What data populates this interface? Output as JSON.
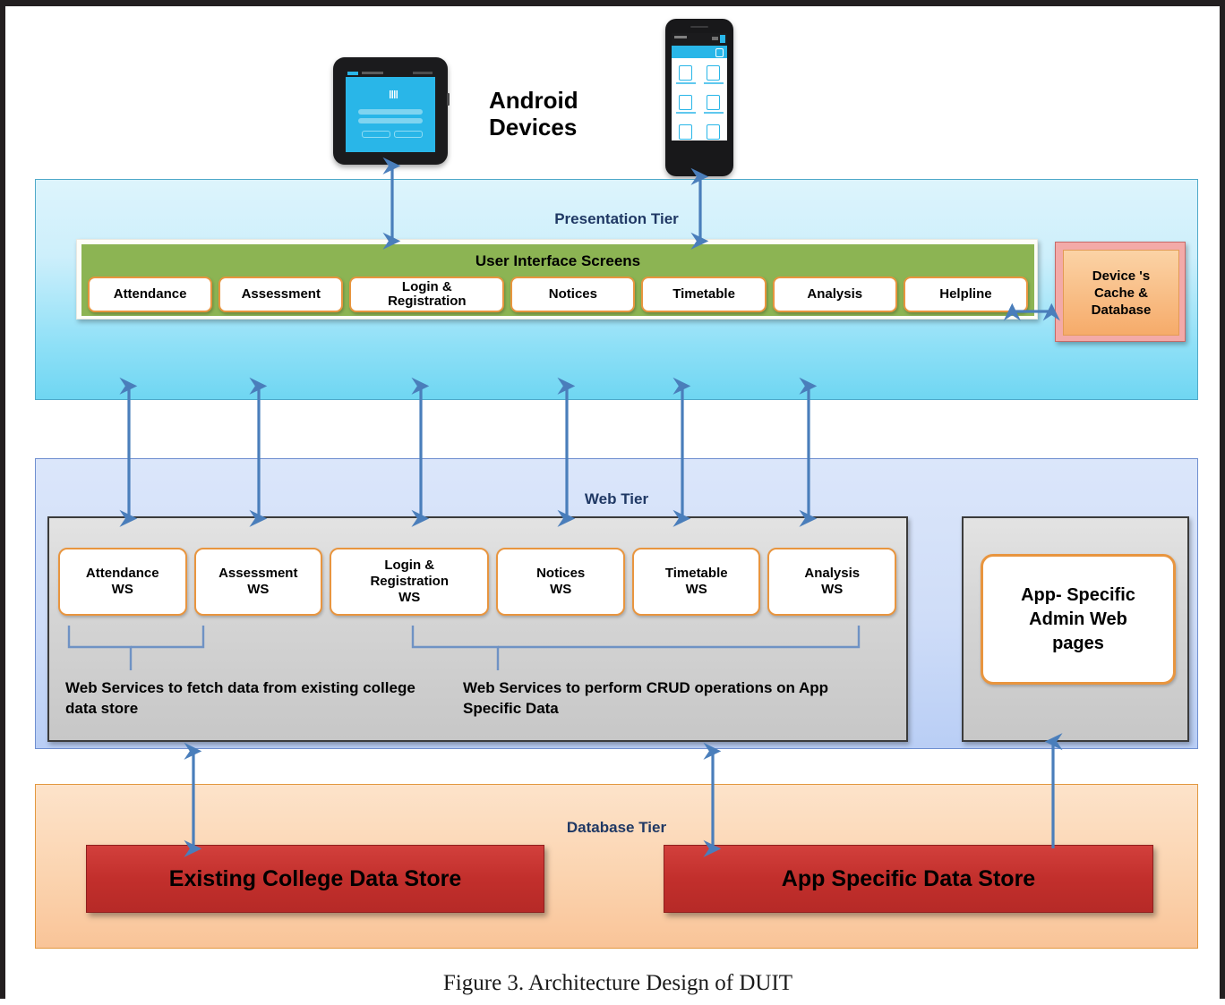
{
  "figure": {
    "caption": "Figure 3. Architecture Design of DUIT"
  },
  "devices": {
    "label": "Android\nDevices",
    "label_line1": "Android",
    "label_line2": "Devices",
    "tablet_icon": "android-tablet-icon",
    "phone_icon": "android-phone-icon"
  },
  "presentation_tier": {
    "title": "Presentation Tier",
    "ui_screens": {
      "title": "User Interface Screens",
      "items": [
        {
          "label": "Attendance",
          "wide": false
        },
        {
          "label": "Assessment",
          "wide": false
        },
        {
          "label": "Login  &\nRegistration",
          "wide": true
        },
        {
          "label": "Notices",
          "wide": false
        },
        {
          "label": "Timetable",
          "wide": false
        },
        {
          "label": "Analysis",
          "wide": false
        },
        {
          "label": "Helpline",
          "wide": false
        }
      ]
    },
    "cache": {
      "label": "Device 's\nCache &\nDatabase"
    }
  },
  "web_tier": {
    "title": "Web Tier",
    "services": [
      {
        "label": "Attendance\nWS",
        "wide": false
      },
      {
        "label": "Assessment\nWS",
        "wide": false
      },
      {
        "label": "Login  &\nRegistration\nWS",
        "wide": true
      },
      {
        "label": "Notices\nWS",
        "wide": false
      },
      {
        "label": "Timetable\nWS",
        "wide": false
      },
      {
        "label": "Analysis\nWS",
        "wide": false
      }
    ],
    "caption_left": "Web Services to fetch data from existing college data store",
    "caption_right": "Web Services to perform CRUD operations on App Specific Data",
    "admin": {
      "label": "App- Specific\nAdmin Web\npages"
    }
  },
  "database_tier": {
    "title": "Database Tier",
    "stores": [
      {
        "label": "Existing College Data Store"
      },
      {
        "label": "App Specific Data Store"
      }
    ]
  },
  "colors": {
    "presentation_tier": "#8fe0f7",
    "web_tier": "#cfddf8",
    "database_tier": "#fbd4b0",
    "ui_screens_panel": "#8cb453",
    "chip_border": "#e8953f",
    "data_store": "#c22f2c",
    "cache_box": "#f3aaa8",
    "arrow": "#4a7ebb",
    "tier_title_text": "#1f3864"
  }
}
